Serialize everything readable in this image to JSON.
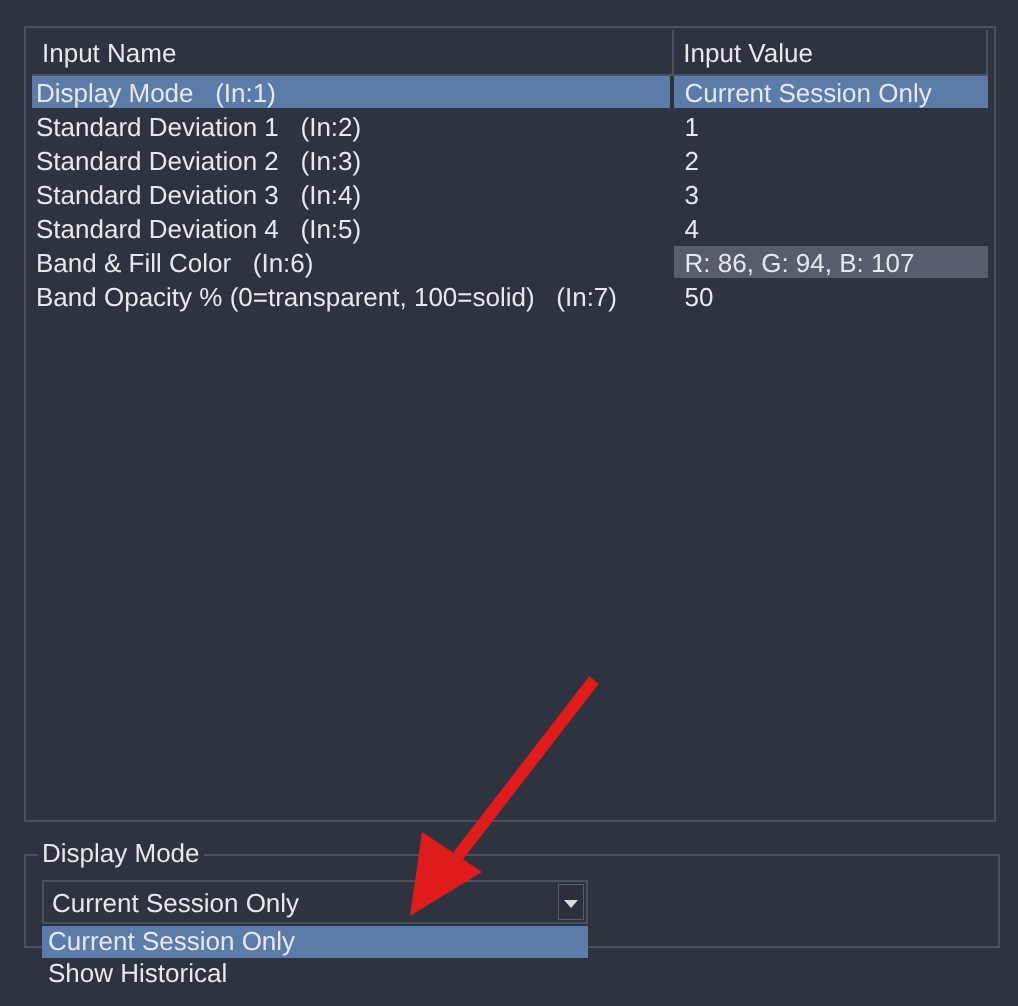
{
  "table": {
    "columns": [
      "Input Name",
      "Input Value"
    ],
    "rows": [
      {
        "name": "Display Mode   (In:1)",
        "value": "Current Session Only",
        "selected": true
      },
      {
        "name": "Standard Deviation 1   (In:2)",
        "value": "1",
        "selected": false
      },
      {
        "name": "Standard Deviation 2   (In:3)",
        "value": "2",
        "selected": false
      },
      {
        "name": "Standard Deviation 3   (In:4)",
        "value": "3",
        "selected": false
      },
      {
        "name": "Standard Deviation 4   (In:5)",
        "value": "4",
        "selected": false
      },
      {
        "name": "Band & Fill Color   (In:6)",
        "value": "R: 86, G: 94, B: 107",
        "selected": false,
        "color": "#565e6b"
      },
      {
        "name": "Band Opacity % (0=transparent, 100=solid)   (In:7)",
        "value": "50",
        "selected": false
      }
    ]
  },
  "group": {
    "title": "Display Mode",
    "combo": {
      "value": "Current Session Only"
    },
    "options": [
      {
        "label": "Current Session Only",
        "selected": true
      },
      {
        "label": "Show Historical",
        "selected": false
      }
    ]
  }
}
